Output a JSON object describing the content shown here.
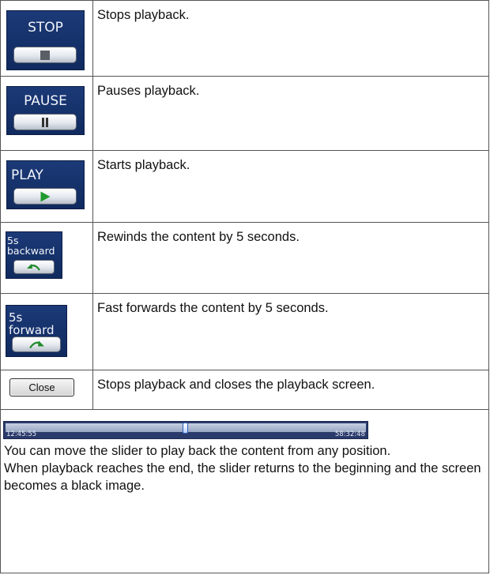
{
  "rows": [
    {
      "panel_label": "STOP",
      "icon": "stop-square-icon",
      "description": "Stops playback."
    },
    {
      "panel_label": "PAUSE",
      "icon": "pause-bars-icon",
      "description": "Pauses playback."
    },
    {
      "panel_label": "PLAY",
      "icon": "play-triangle-icon",
      "description": "Starts playback."
    },
    {
      "panel_label_line1": "5s",
      "panel_label_line2": "backward",
      "icon": "rewind-arrow-icon",
      "description": "Rewinds the content by 5 seconds."
    },
    {
      "panel_label_line1": "5s",
      "panel_label_line2": "forward",
      "icon": "forward-arrow-icon",
      "description": "Fast forwards the content by 5 seconds."
    },
    {
      "button_label": "Close",
      "description": "Stops playback and closes the playback screen."
    }
  ],
  "slider": {
    "start_time": "12:45:55",
    "end_time": "58:32:48",
    "position": 0.495,
    "text_line1": "You can move the slider to play back the content from any position.",
    "text_line2": "When playback reaches the end, the slider returns to the beginning and the screen becomes a black image."
  },
  "colors": {
    "panel": "#15306a",
    "play_green": "#1f9a2e"
  }
}
